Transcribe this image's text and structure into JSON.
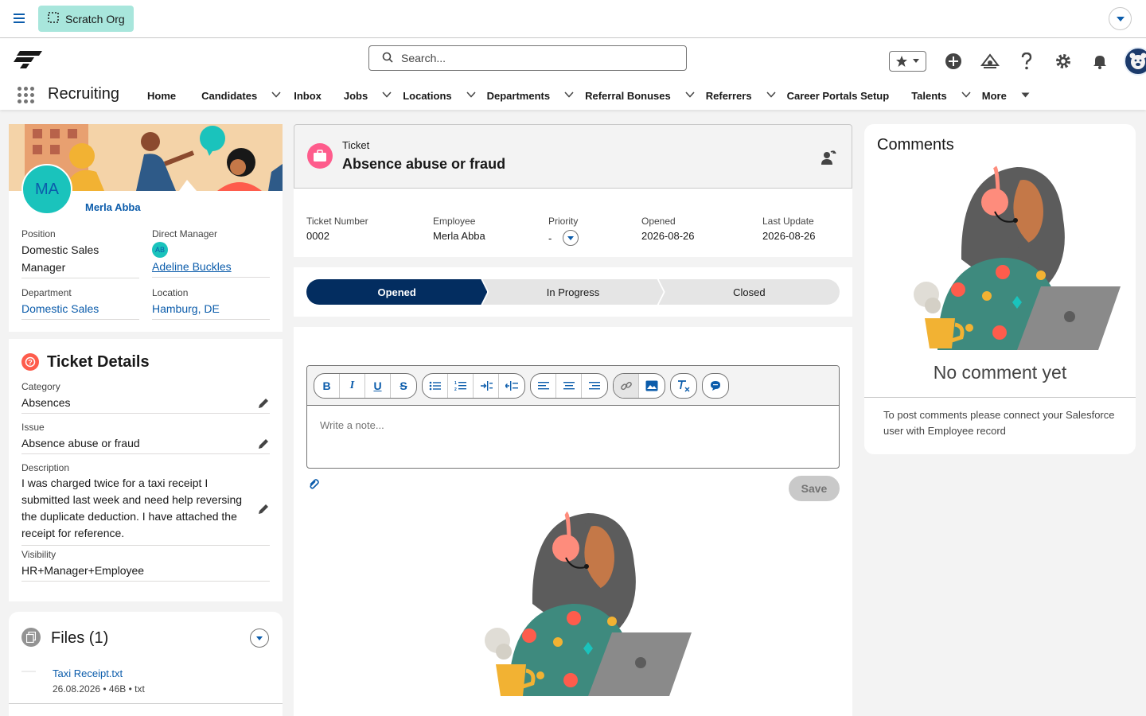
{
  "topbar": {
    "org_label": "Scratch Org"
  },
  "header": {
    "search_placeholder": "Search...",
    "app_name": "Recruiting",
    "nav": [
      {
        "label": "Home",
        "has_menu": false
      },
      {
        "label": "Candidates",
        "has_menu": true
      },
      {
        "label": "Inbox",
        "has_menu": false
      },
      {
        "label": "Jobs",
        "has_menu": true
      },
      {
        "label": "Locations",
        "has_menu": true
      },
      {
        "label": "Departments",
        "has_menu": true
      },
      {
        "label": "Referral Bonuses",
        "has_menu": true
      },
      {
        "label": "Referrers",
        "has_menu": true
      },
      {
        "label": "Career Portals Setup",
        "has_menu": false
      },
      {
        "label": "Talents",
        "has_menu": true
      },
      {
        "label": "More",
        "has_menu": true
      }
    ]
  },
  "profile": {
    "initials": "MA",
    "name": "Merla Abba",
    "position_label": "Position",
    "position_value": "Domestic Sales Manager",
    "manager_label": "Direct Manager",
    "manager_initials": "AB",
    "manager_value": "Adeline Buckles",
    "department_label": "Department",
    "department_value": "Domestic Sales",
    "location_label": "Location",
    "location_value": "Hamburg, DE"
  },
  "details": {
    "title": "Ticket Details",
    "category_label": "Category",
    "category_value": "Absences",
    "issue_label": "Issue",
    "issue_value": "Absence abuse or fraud",
    "description_label": "Description",
    "description_value": "I was charged twice for a taxi receipt I submitted last week and need help reversing the duplicate deduction. I have attached the receipt for reference.",
    "visibility_label": "Visibility",
    "visibility_value": "HR+Manager+Employee"
  },
  "files": {
    "title": "Files (1)",
    "items": [
      {
        "name": "Taxi Receipt.txt",
        "meta": "26.08.2026 • 46B • txt"
      }
    ]
  },
  "ticket": {
    "type_label": "Ticket",
    "title": "Absence abuse or fraud",
    "fields": [
      {
        "label": "Ticket Number",
        "value": "0002"
      },
      {
        "label": "Employee",
        "value": "Merla Abba"
      },
      {
        "label": "Priority",
        "value": "-"
      },
      {
        "label": "Opened",
        "value": "2026-08-26"
      },
      {
        "label": "Last Update",
        "value": "2026-08-26"
      }
    ],
    "path": [
      {
        "label": "Opened",
        "active": true
      },
      {
        "label": "In Progress",
        "active": false
      },
      {
        "label": "Closed",
        "active": false
      }
    ],
    "note_placeholder": "Write a note...",
    "save_label": "Save"
  },
  "comments": {
    "title": "Comments",
    "empty_title": "No comment yet",
    "empty_message": "To post comments please connect your Salesforce user with Employee record"
  },
  "colors": {
    "brand": "#0b5cab",
    "path_active": "#032d60",
    "teal": "#1ac3bc",
    "orange": "#fe5c4c"
  }
}
